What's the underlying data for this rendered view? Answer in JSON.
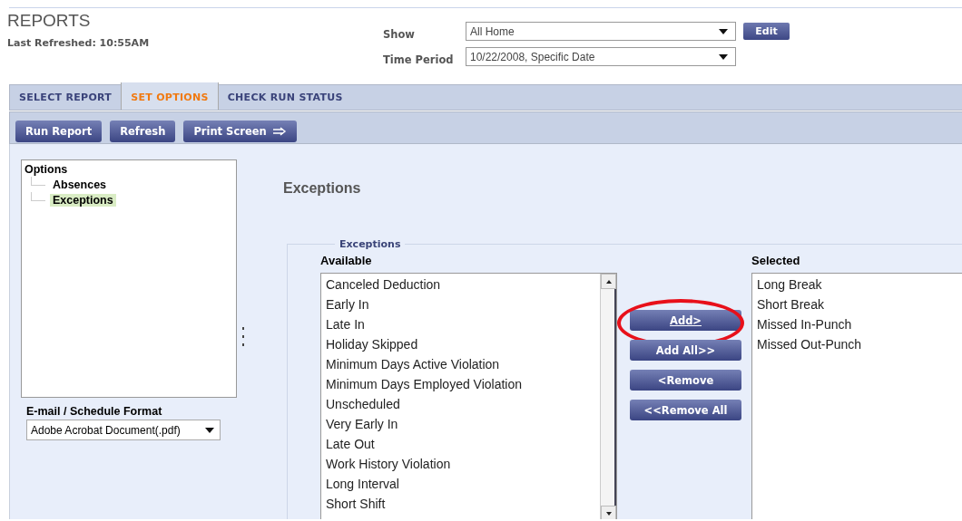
{
  "page": {
    "title": "REPORTS",
    "last_refreshed": "Last Refreshed: 10:55AM"
  },
  "filters": [
    {
      "label": "Show",
      "value": "All Home",
      "button": "Edit"
    },
    {
      "label": "Time Period",
      "value": "10/22/2008, Specific Date"
    }
  ],
  "tabs": [
    {
      "label": "SELECT REPORT",
      "selected": false
    },
    {
      "label": "SET OPTIONS",
      "selected": true
    },
    {
      "label": "CHECK RUN STATUS",
      "selected": false
    }
  ],
  "toolbar": [
    {
      "label": "Run Report",
      "arrow": false
    },
    {
      "label": "Refresh",
      "arrow": false
    },
    {
      "label": "Print Screen",
      "arrow": true
    }
  ],
  "options_tree": {
    "label": "Options",
    "children": [
      {
        "label": "Absences",
        "selected": false
      },
      {
        "label": "Exceptions",
        "selected": true
      }
    ]
  },
  "format": {
    "label": "E-mail / Schedule Format",
    "value": "Adobe Acrobat Document(.pdf)"
  },
  "section_title": "Exceptions",
  "group": {
    "legend": "Exceptions",
    "available": {
      "label": "Available",
      "items": [
        "Canceled Deduction",
        "Early In",
        "Late In",
        "Holiday Skipped",
        "Minimum Days Active Violation",
        "Minimum Days Employed Violation",
        "Unscheduled",
        "Very Early In",
        "Late Out",
        "Work History Violation",
        "Long Interval",
        "Short Shift"
      ]
    },
    "buttons": [
      {
        "label": "Add>",
        "focused": true,
        "circled": true
      },
      {
        "label": "Add All>>",
        "focused": false,
        "circled": false
      },
      {
        "label": "<Remove",
        "focused": false,
        "circled": false
      },
      {
        "label": "<<Remove All",
        "focused": false,
        "circled": false
      }
    ],
    "selected": {
      "label": "Selected",
      "items": [
        "Long Break",
        "Short Break",
        "Missed In-Punch",
        "Missed Out-Punch"
      ]
    }
  }
}
